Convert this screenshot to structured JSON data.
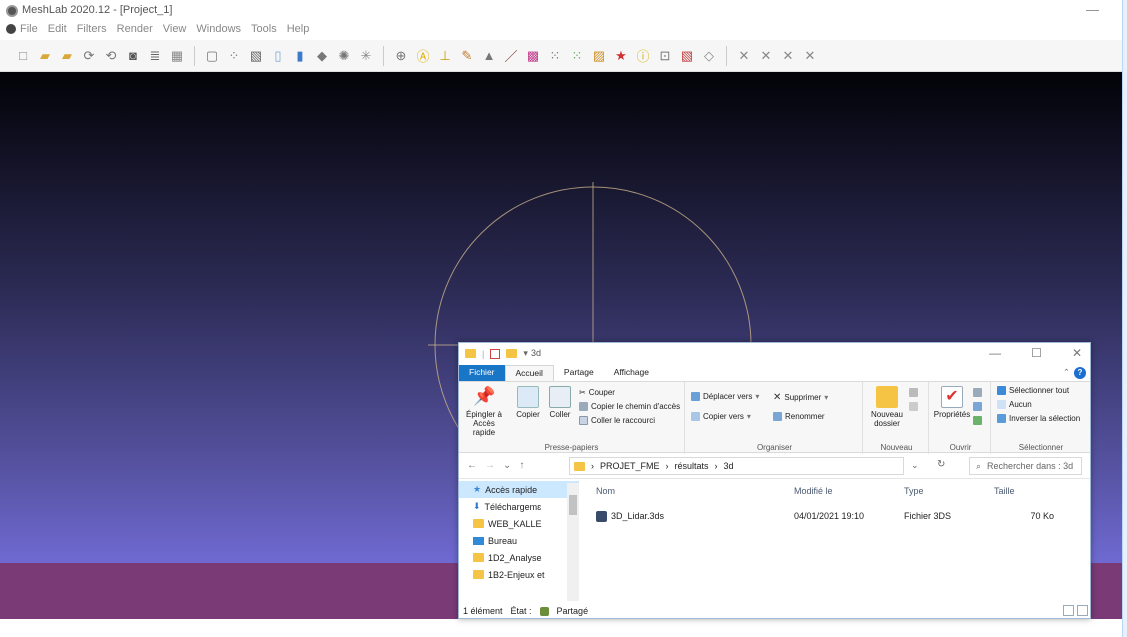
{
  "meshlab": {
    "window_title": "MeshLab 2020.12 - [Project_1]",
    "minimize_glyph": "—",
    "menus": [
      "File",
      "Edit",
      "Filters",
      "Render",
      "View",
      "Windows",
      "Tools",
      "Help"
    ],
    "toolbar_icons": [
      "new-project-icon",
      "open-project-icon",
      "import-mesh-icon",
      "reload-icon",
      "reload-all-icon",
      "snapshot-icon",
      "layers-icon",
      "raster-icon",
      "bbox-icon",
      "points-icon",
      "wireframe-icon",
      "flat-icon",
      "smooth-icon",
      "texture-icon",
      "light-icon",
      "normals-icon",
      "sphere-icon",
      "annotation-icon",
      "measure-icon",
      "paint-icon",
      "pick-points-icon",
      "edit-pencil-icon",
      "color-icon",
      "select-faces-icon",
      "select-vertices-icon",
      "align-icon",
      "reference-icon",
      "info-icon",
      "select-connected-icon",
      "select-area-icon",
      "manipulator-icon",
      "mutual-info-icon",
      "select-z-icon",
      "delete-faces-icon",
      "delete-vertices-icon"
    ],
    "colors": {
      "bg_top": "#020207",
      "bg_bottom": "#6f6ad2",
      "floor": "#7a3a76",
      "trackball": "#c9b08a"
    }
  },
  "explorer": {
    "title_path": "3d",
    "window_buttons": [
      "—",
      "☐",
      "✕"
    ],
    "tabs": [
      {
        "label": "Fichier"
      },
      {
        "label": "Accueil"
      },
      {
        "label": "Partage"
      },
      {
        "label": "Affichage"
      }
    ],
    "ribbon": {
      "pin_label": "Épingler à Accès rapide",
      "copy_label": "Copier",
      "paste_label": "Coller",
      "cut_label": "Couper",
      "copy_path_label": "Copier le chemin d'accès",
      "paste_shortcut_label": "Coller le raccourci",
      "group_clipboard": "Presse-papiers",
      "move_to_label": "Déplacer vers",
      "copy_to_label": "Copier vers",
      "delete_label": "Supprimer",
      "rename_label": "Renommer",
      "group_organize": "Organiser",
      "new_folder_label": "Nouveau dossier",
      "group_new": "Nouveau",
      "properties_label": "Propriétés",
      "group_open": "Ouvrir",
      "select_all_label": "Sélectionner tout",
      "select_none_label": "Aucun",
      "invert_label": "Inverser la sélection",
      "group_select": "Sélectionner"
    },
    "address": {
      "crumbs": [
        "PROJET_FME",
        "résultats",
        "3d"
      ],
      "search_placeholder": "Rechercher dans : 3d"
    },
    "nav": [
      {
        "label": "Accès rapide",
        "pinned": false
      },
      {
        "label": "Téléchargemɛ",
        "pinned": true
      },
      {
        "label": "WEB_KALLE",
        "pinned": true
      },
      {
        "label": "Bureau",
        "pinned": true
      },
      {
        "label": "1D2_Analyse",
        "pinned": true
      },
      {
        "label": "1B2-Enjeux et",
        "pinned": true
      }
    ],
    "columns": [
      "Nom",
      "Modifié le",
      "Type",
      "Taille"
    ],
    "files": [
      {
        "name": "3D_Lidar.3ds",
        "modified": "04/01/2021 19:10",
        "type": "Fichier 3DS",
        "size": "70 Ko"
      }
    ],
    "status": {
      "count": "1 élément",
      "state": "État :",
      "shared": "Partagé"
    }
  }
}
